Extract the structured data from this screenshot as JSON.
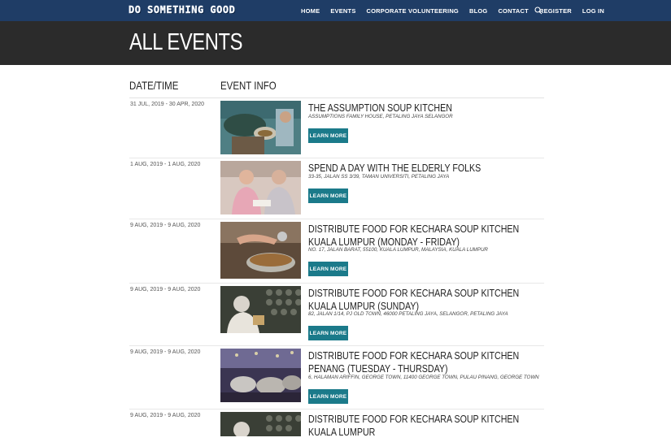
{
  "navbar": {
    "logo": "DO SOMETHING GOOD",
    "links": [
      "HOME",
      "EVENTS",
      "CORPORATE VOLUNTEERING",
      "BLOG",
      "CONTACT",
      "REGISTER",
      "LOG IN"
    ],
    "search_icon": "search-icon"
  },
  "hero": {
    "title": "ALL EVENTS"
  },
  "table": {
    "headers": {
      "date": "DATE/TIME",
      "info": "EVENT INFO"
    }
  },
  "events": [
    {
      "date": "31 JUL, 2019 - 30 APR, 2020",
      "title": "THE ASSUMPTION SOUP KITCHEN",
      "address": "ASSUMPTIONS FAMILY HOUSE, PETALING JAYA SELANGOR",
      "button": "LEARN MORE"
    },
    {
      "date": "1 AUG, 2019 - 1 AUG, 2020",
      "title": "SPEND A DAY WITH THE ELDERLY FOLKS",
      "address": "33-35, JALAN SS 3/39, TAMAN UNIVERSITI, PETALING JAYA",
      "button": "LEARN MORE"
    },
    {
      "date": "9 AUG, 2019 - 9 AUG, 2020",
      "title": "DISTRIBUTE FOOD FOR KECHARA SOUP KITCHEN KUALA LUMPUR (MONDAY - FRIDAY)",
      "address": "NO. 17, JALAN BARAT, 55100, KUALA LUMPUR, MALAYSIA, KUALA LUMPUR",
      "button": "LEARN MORE"
    },
    {
      "date": "9 AUG, 2019 - 9 AUG, 2020",
      "title": "DISTRIBUTE FOOD FOR KECHARA SOUP KITCHEN KUALA LUMPUR (SUNDAY)",
      "address": "82, JALAN 1/14, PJ OLD TOWN, 46000 PETALING JAYA, SELANGOR, PETALING JAYA",
      "button": "LEARN MORE"
    },
    {
      "date": "9 AUG, 2019 - 9 AUG, 2020",
      "title": "DISTRIBUTE FOOD FOR KECHARA SOUP KITCHEN PENANG (TUESDAY - THURSDAY)",
      "address": "6, HALAMAN ARIFFIN, GEORGE TOWN, 11400 GEORGE TOWN, PULAU PINANG, GEORGE TOWN",
      "button": "LEARN MORE"
    },
    {
      "date": "9 AUG, 2019 - 9 AUG, 2020",
      "title": "DISTRIBUTE FOOD FOR KECHARA SOUP KITCHEN KUALA LUMPUR",
      "address": "",
      "button": ""
    }
  ],
  "colors": {
    "navbar": "#1f3d66",
    "hero": "#2b2b2b",
    "button": "#1b7a8a"
  }
}
